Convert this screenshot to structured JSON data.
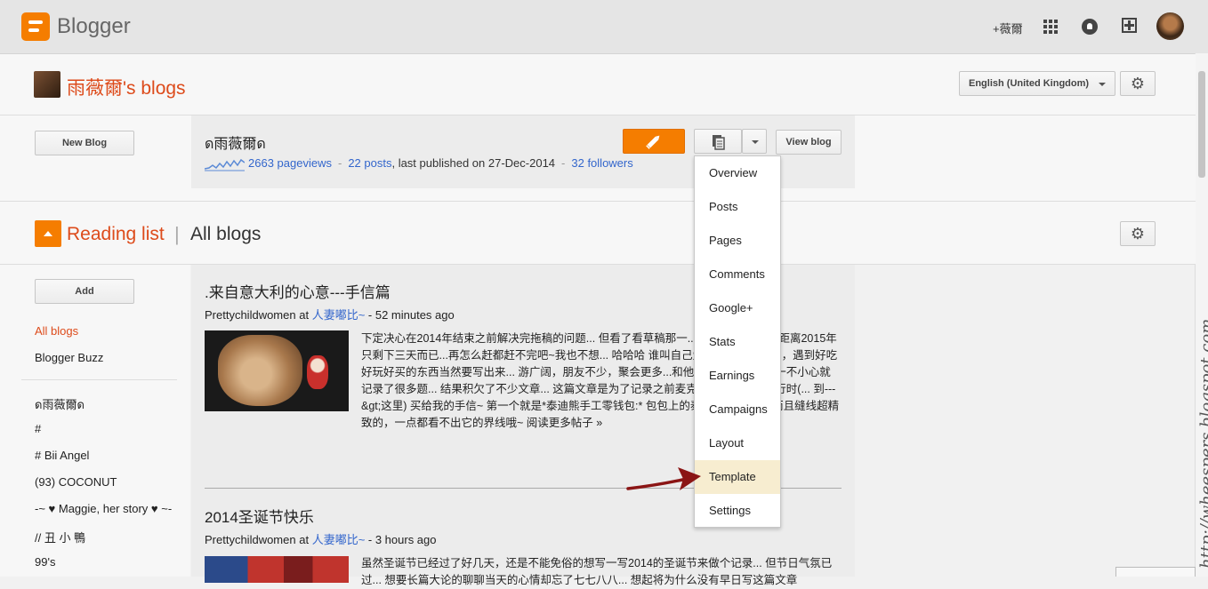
{
  "header": {
    "app_name": "Blogger",
    "user_name": "+薇爾"
  },
  "blogs_section": {
    "title": "雨薇爾's blogs",
    "language": "English (United Kingdom)"
  },
  "blog": {
    "new_blog_label": "New Blog",
    "name": "ด雨薇爾ด",
    "pageviews": "2663 pageviews",
    "posts": "22 posts",
    "last_published": ", last published on 27-Dec-2014",
    "followers": "32 followers",
    "view_blog_label": "View blog"
  },
  "menu": {
    "items": [
      "Overview",
      "Posts",
      "Pages",
      "Comments",
      "Google+",
      "Stats",
      "Earnings",
      "Campaigns",
      "Layout",
      "Template",
      "Settings"
    ],
    "highlighted": "Template"
  },
  "reading": {
    "title": "Reading list",
    "separator": "|",
    "subtitle": "All blogs",
    "add_label": "Add",
    "sidebar_primary": [
      "All blogs",
      "Blogger Buzz"
    ],
    "sidebar_blogs": [
      "ด雨薇爾ด",
      "#",
      "# Bii Angel",
      "(93) COCONUT",
      "-~ ♥ Maggie, her story ♥ ~-",
      "// 丑 小 鴨",
      "99's"
    ]
  },
  "posts": [
    {
      "title": ".来自意大利的心意---手信篇",
      "author": "Prettychildwomen",
      "at": " at ",
      "blog": "人妻嘟比~",
      "time": " - 52 minutes ago",
      "excerpt": "下定决心在2014年结束之前解决完拖稿的问题... 但看了看草稿那一... 还是慢慢写吧... 距离2015年只剩下三天而已...再怎么赶都赶不完吧~我也不想... 哈哈哈 谁叫自己爱吃爱玩爱逛爱闹，遇到好吃好玩好买的东西当然要写出来... 游广阔，朋友不少，聚会更多...和他/她们聊天的时候一不小心就记录了很多题... 结果积欠了不少文章... 这篇文章是为了记录之前麦克父母去意大利旅行时(... 到---&gt;这里) 买给我的手信~ 第一个就是*泰迪熊手工零钱包:* 包包上的泰迪... 工缝制， 而且缝线超精致的，一点都看不出它的界线哦~ 阅读更多帖子 »"
    },
    {
      "title": "2014圣诞节快乐",
      "author": "Prettychildwomen",
      "at": " at ",
      "blog": "人妻嘟比~",
      "time": " - 3 hours ago",
      "excerpt": "虽然圣诞节已经过了好几天，还是不能免俗的想写一写2014的圣诞节来做个记录... 但节日气氛已过... 想要长篇大论的聊聊当天的心情却忘了七七八八... 想起将为什么没有早日写这篇文章"
    }
  ],
  "watermark": "http://wheespers.blogspot.com"
}
